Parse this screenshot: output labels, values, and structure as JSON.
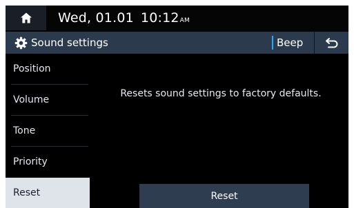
{
  "status_bar": {
    "home_icon": "home-icon",
    "date": "Wed, 01.01",
    "time": "10:12",
    "ampm": "AM"
  },
  "title_bar": {
    "settings_icon": "gear-icon",
    "title": "Sound settings",
    "beep_label": "Beep",
    "back_icon": "back-arrow-icon"
  },
  "sidebar": {
    "items": [
      {
        "label": "Position"
      },
      {
        "label": "Volume"
      },
      {
        "label": "Tone"
      },
      {
        "label": "Priority"
      },
      {
        "label": "Reset",
        "selected": true
      }
    ]
  },
  "main": {
    "message": "Resets sound settings to factory defaults.",
    "reset_button": "Reset"
  },
  "colors": {
    "title_bar": "#2c3a4e",
    "selected_item": "#dfe4ea",
    "accent": "#2ea8ff",
    "button": "#2f3d50"
  }
}
